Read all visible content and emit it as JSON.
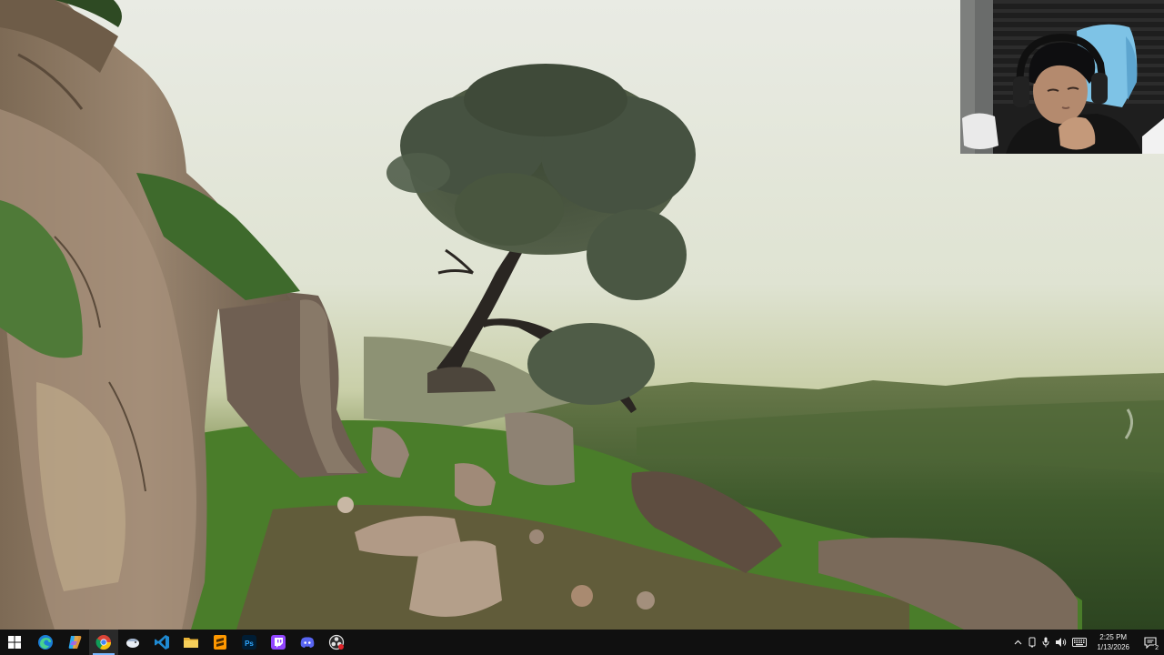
{
  "scene": {
    "description_hidden": "",
    "colors": {
      "sky": "#e6e8de",
      "haze": "#c8d0a8",
      "valley": "#3f5a2c",
      "grass": "#4f8a2a",
      "rock": "#8a7a6a"
    }
  },
  "webcam": {
    "visible": true
  },
  "taskbar": {
    "start": {
      "icon": "windows-start-icon"
    },
    "apps": [
      {
        "name": "edge",
        "icon": "edge-icon",
        "running": false,
        "active": false
      },
      {
        "name": "copilot",
        "icon": "copilot-icon",
        "running": false,
        "active": false
      },
      {
        "name": "chrome",
        "icon": "chrome-icon",
        "running": true,
        "active": true
      },
      {
        "name": "app-4",
        "icon": "bird-app-icon",
        "running": false,
        "active": false
      },
      {
        "name": "vscode",
        "icon": "vscode-icon",
        "running": false,
        "active": false
      },
      {
        "name": "file-explorer",
        "icon": "folder-icon",
        "running": false,
        "active": false
      },
      {
        "name": "sublime-text",
        "icon": "sublime-icon",
        "running": false,
        "active": false
      },
      {
        "name": "photoshop",
        "icon": "photoshop-icon",
        "running": false,
        "active": false
      },
      {
        "name": "twitch",
        "icon": "twitch-icon",
        "running": false,
        "active": false
      },
      {
        "name": "discord",
        "icon": "discord-icon",
        "running": false,
        "active": false
      },
      {
        "name": "obs",
        "icon": "obs-icon",
        "running": false,
        "active": false
      }
    ],
    "tray": {
      "chevron": "^",
      "clock_time": "2:25 PM",
      "clock_date": "1/13/2026",
      "notification_count": "2"
    }
  }
}
